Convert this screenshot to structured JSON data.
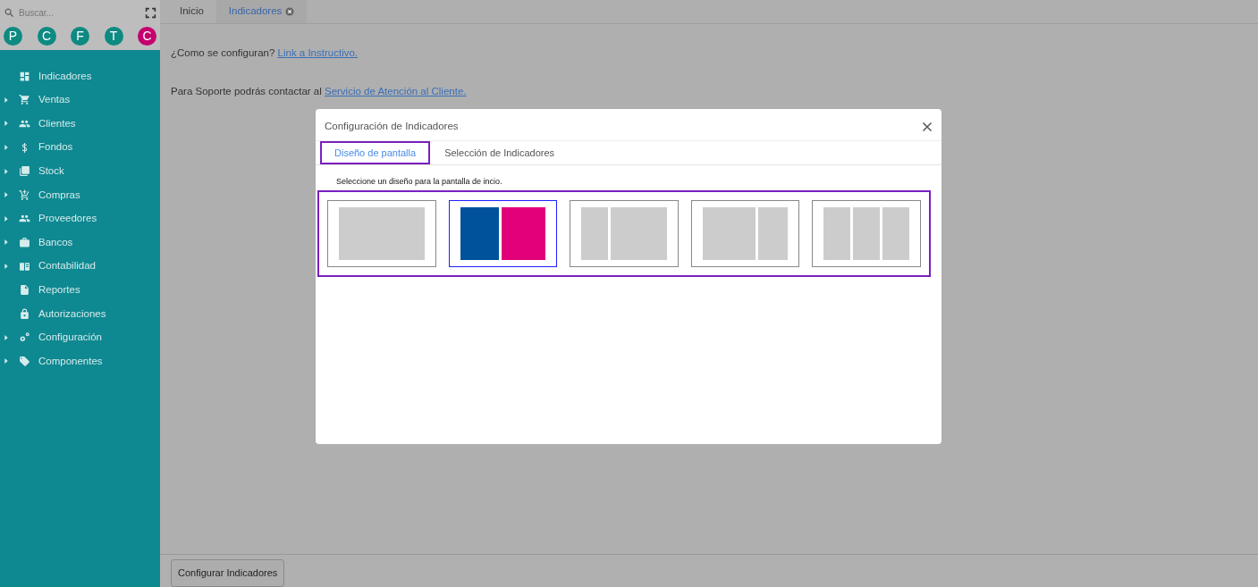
{
  "sidebar": {
    "search": {
      "placeholder": "Buscar..."
    },
    "avatars": [
      {
        "letter": "P",
        "color": "#0d8a82"
      },
      {
        "letter": "C",
        "color": "#0d8a82"
      },
      {
        "letter": "F",
        "color": "#0d8a82"
      },
      {
        "letter": "T",
        "color": "#0d8a82"
      },
      {
        "letter": "C",
        "color": "#c4006e"
      }
    ],
    "items": [
      {
        "label": "Indicadores",
        "expandable": false
      },
      {
        "label": "Ventas",
        "expandable": true
      },
      {
        "label": "Clientes",
        "expandable": true
      },
      {
        "label": "Fondos",
        "expandable": true
      },
      {
        "label": "Stock",
        "expandable": true
      },
      {
        "label": "Compras",
        "expandable": true
      },
      {
        "label": "Proveedores",
        "expandable": true
      },
      {
        "label": "Bancos",
        "expandable": true
      },
      {
        "label": "Contabilidad",
        "expandable": true
      },
      {
        "label": "Reportes",
        "expandable": false
      },
      {
        "label": "Autorizaciones",
        "expandable": false
      },
      {
        "label": "Configuración",
        "expandable": true
      },
      {
        "label": "Componentes",
        "expandable": true
      }
    ]
  },
  "tabs": [
    {
      "label": "Inicio",
      "selected": false,
      "closable": false
    },
    {
      "label": "Indicadores",
      "selected": true,
      "closable": true
    }
  ],
  "content": {
    "lines": [
      {
        "text": "¿Como se configuran?",
        "link": "Link a Instructivo."
      },
      {
        "text": "Para Soporte podrás contactar al",
        "link": "Servicio de Atención al Cliente."
      }
    ],
    "button": "Configurar Indicadores"
  },
  "modal": {
    "title": "Configuración de Indicadores",
    "tabs": [
      {
        "label": "Diseño de pantalla",
        "selected": true,
        "highlighted": true
      },
      {
        "label": "Selección de Indicadores",
        "selected": false,
        "highlighted": false
      }
    ],
    "instruction": "Seleccione un diseño para la pantalla de incio.",
    "layouts_highlighted": true,
    "layouts": [
      {
        "kind": "single",
        "selected": false
      },
      {
        "kind": "halves",
        "selected": true
      },
      {
        "kind": "narrow-wide",
        "selected": false
      },
      {
        "kind": "wide-narrow",
        "selected": false
      },
      {
        "kind": "thirds",
        "selected": false
      }
    ]
  }
}
